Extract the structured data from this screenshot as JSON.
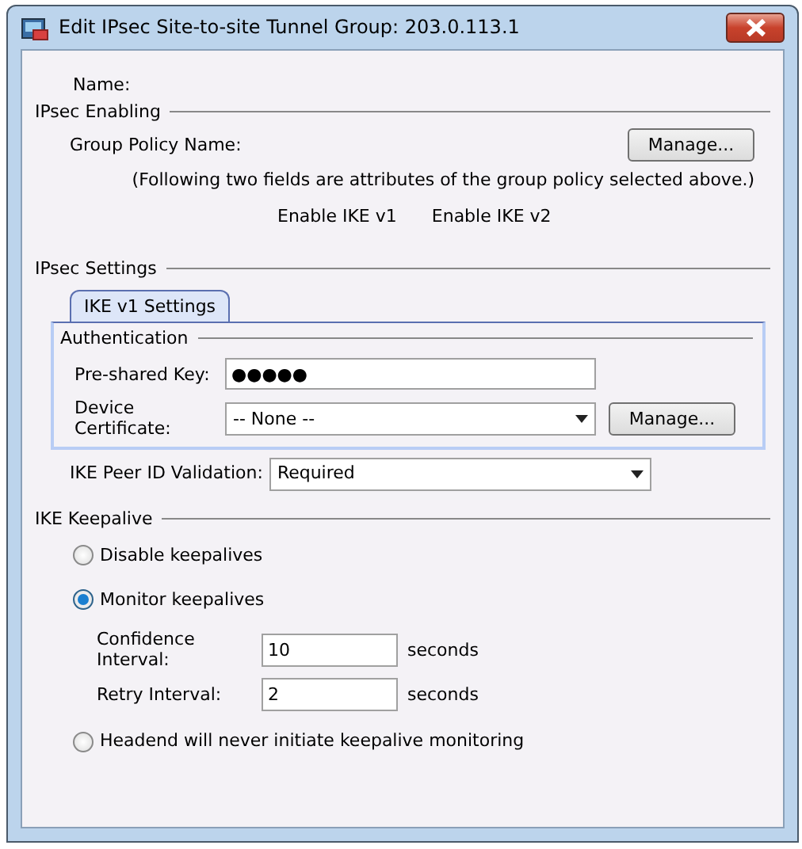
{
  "window": {
    "title": "Edit IPsec Site-to-site Tunnel Group: 203.0.113.1"
  },
  "name_label": "Name:",
  "ipsec_enabling": {
    "title": "IPsec Enabling",
    "group_policy_label": "Group Policy Name:",
    "manage_button": "Manage...",
    "note": "(Following two fields are attributes of the group policy selected above.)",
    "ike_v1_label": "Enable IKE v1",
    "ike_v2_label": "Enable IKE v2"
  },
  "ipsec_settings": {
    "title": "IPsec Settings",
    "tabs": [
      {
        "label": "IKE v1 Settings",
        "selected": true
      }
    ],
    "authentication": {
      "title": "Authentication",
      "preshared_key": {
        "label": "Pre-shared Key:",
        "value": "●●●●●"
      },
      "device_certificate": {
        "label": "Device Certificate:",
        "value": "-- None --",
        "manage_button": "Manage..."
      }
    },
    "peer_id_validation": {
      "label": "IKE Peer ID Validation:",
      "value": "Required"
    }
  },
  "ike_keepalive": {
    "title": "IKE Keepalive",
    "options": [
      {
        "label": "Disable keepalives",
        "selected": false
      },
      {
        "label": "Monitor keepalives",
        "selected": true,
        "fields": [
          {
            "label": "Confidence Interval:",
            "value": "10",
            "unit": "seconds"
          },
          {
            "label": "Retry Interval:",
            "value": "2",
            "unit": "seconds"
          }
        ]
      },
      {
        "label": "Headend will never initiate keepalive monitoring",
        "selected": false
      }
    ]
  }
}
